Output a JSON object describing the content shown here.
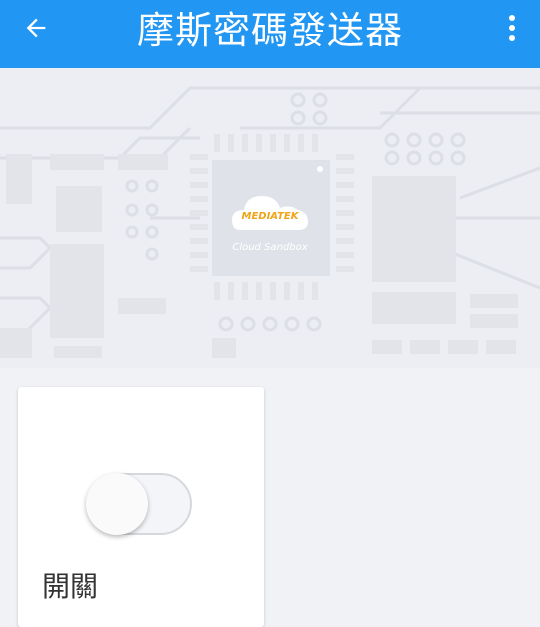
{
  "appbar": {
    "title": "摩斯密碼發送器",
    "back_icon": "arrow-left-icon",
    "menu_icon": "more-vert-icon",
    "color": "#2196f3"
  },
  "banner": {
    "logo_text": "MEDIATEK",
    "logo_subtitle": "Cloud Sandbox"
  },
  "card": {
    "switch_state": "off",
    "label": "開關"
  }
}
